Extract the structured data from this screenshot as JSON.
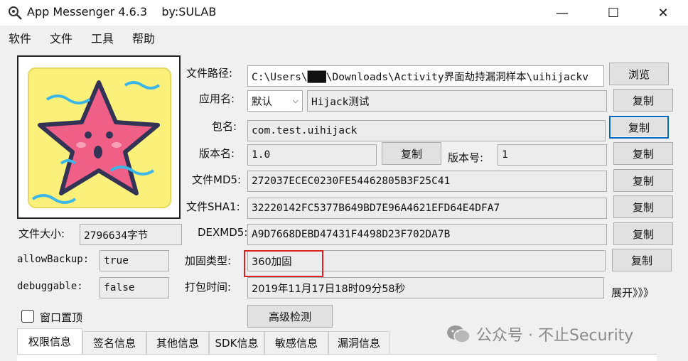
{
  "window": {
    "title": "App Messenger 4.6.3    by:SULAB",
    "minimize": "—",
    "maximize": "☐",
    "close": "✕"
  },
  "menu": [
    "软件",
    "文件",
    "工具",
    "帮助"
  ],
  "form": {
    "path_label": "文件路径:",
    "path_value": "C:\\Users\\███\\Downloads\\Activity界面劫持漏洞样本\\uihijackv",
    "browse": "浏览",
    "appname_label": "应用名:",
    "appname_select": "默认",
    "appname_value": "Hijack测试",
    "package_label": "包名:",
    "package_value": "com.test.uihijack",
    "version_name_label": "版本名:",
    "version_name_value": "1.0",
    "version_code_label": "版本号:",
    "version_code_value": "1",
    "md5_label": "文件MD5:",
    "md5_value": "272037ECEC0230FE54462805B3F25C41",
    "sha1_label": "文件SHA1:",
    "sha1_value": "32220142FC5377B649BD7E96A4621EFD64E4DFA7",
    "dexmd5_label": "DEXMD5:",
    "dexmd5_value": "A9D7668DEBD47431F4498D23F702DA7B",
    "protect_label": "加固类型:",
    "protect_value": "360加固",
    "packtime_label": "打包时间:",
    "packtime_value": "2019年11月17日18时09分58秒",
    "expand": "展开》》》",
    "copy": "复制",
    "filesize_label": "文件大小:",
    "filesize_value": "2796634字节",
    "allowbackup_label": "allowBackup:",
    "allowbackup_value": "true",
    "debuggable_label": "debuggable:",
    "debuggable_value": "false",
    "topmost_label": "窗口置顶",
    "advanced": "高级检测"
  },
  "tabs": [
    "权限信息",
    "签名信息",
    "其他信息",
    "SDK信息",
    "敏感信息",
    "漏洞信息"
  ],
  "watermark": "公众号 · 不止Security",
  "colors": {
    "highlight": "#e02020",
    "focus": "#0067c0"
  }
}
